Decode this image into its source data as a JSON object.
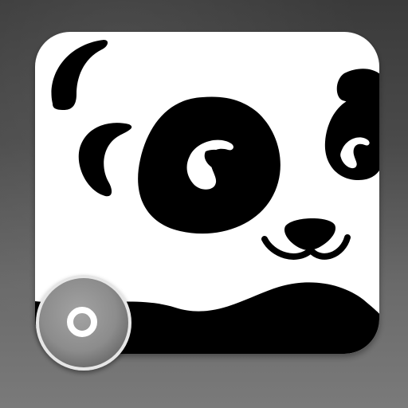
{
  "app_icon": {
    "icon": "panda-face-icon",
    "background_color": "#ffffff",
    "artwork_color": "#000000"
  },
  "badge": {
    "icon": "ring-icon",
    "color": "#8c8c8c",
    "rim_color": "#e6e6e6",
    "center_color": "#ffffff"
  },
  "colors": {
    "background_top": "#3a3a3a",
    "background_bottom": "#7a7a7a"
  }
}
